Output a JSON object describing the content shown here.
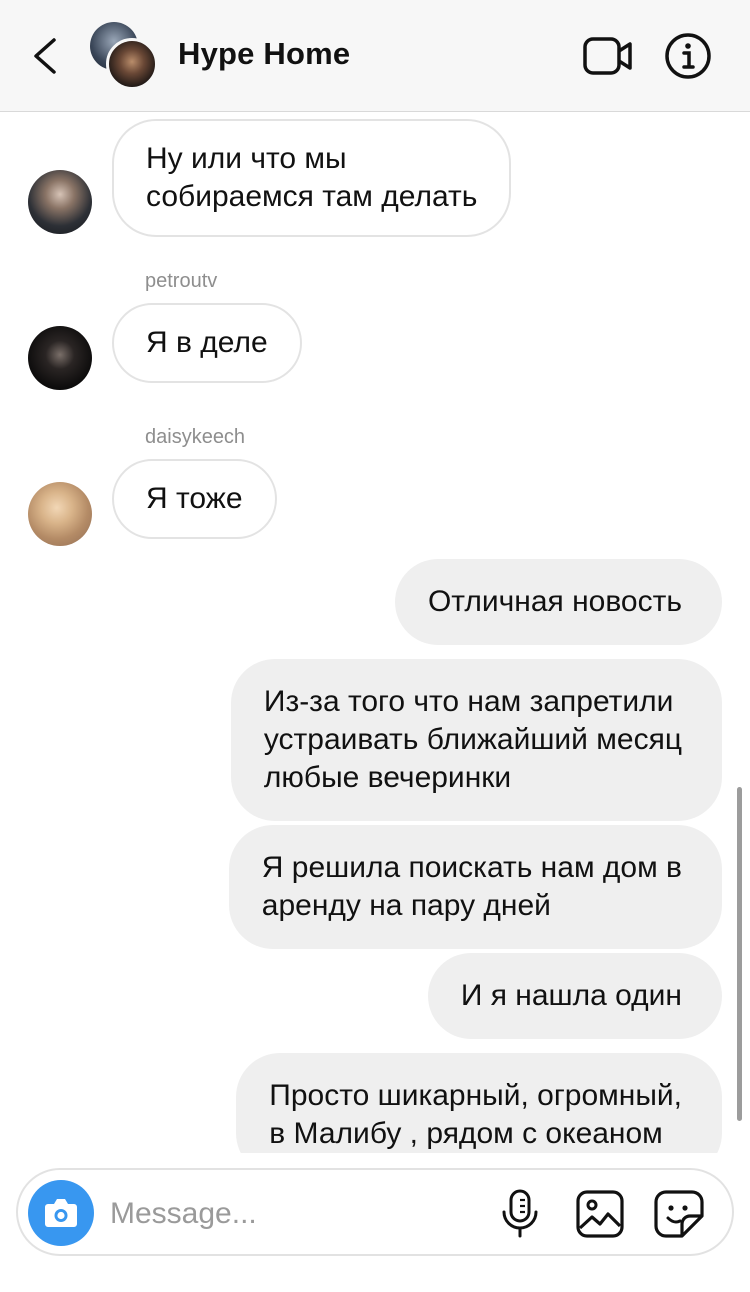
{
  "header": {
    "title": "Hype Home",
    "back_icon": "chevron-left-icon",
    "video_icon": "video-camera-icon",
    "info_icon": "info-icon"
  },
  "messages": [
    {
      "direction": "in",
      "sender": "",
      "text_lines": [
        "Ну или что мы",
        "собираемся там делать"
      ]
    },
    {
      "direction": "in",
      "sender": "petroutv",
      "text_lines": [
        "Я в деле"
      ]
    },
    {
      "direction": "in",
      "sender": "daisykeech",
      "text_lines": [
        "Я тоже"
      ]
    },
    {
      "direction": "out",
      "text_lines": [
        "Отличная новость"
      ]
    },
    {
      "direction": "out",
      "text_lines": [
        "Из-за того что нам запретили",
        "устраивать ближайший месяц",
        "любые вечеринки"
      ]
    },
    {
      "direction": "out",
      "text_lines": [
        "Я решила поискать нам дом в",
        "аренду на пару дней"
      ]
    },
    {
      "direction": "out",
      "text_lines": [
        "И я нашла один"
      ]
    },
    {
      "direction": "out",
      "text_lines": [
        "Просто шикарный, огромный,",
        "в Малибу , рядом с океаном"
      ]
    }
  ],
  "composer": {
    "placeholder": "Message...",
    "camera_icon": "camera-icon",
    "mic_icon": "microphone-icon",
    "gallery_icon": "image-gallery-icon",
    "sticker_icon": "sticker-icon"
  },
  "colors": {
    "accent": "#3897f0",
    "outgoing_bubble": "#efefef",
    "header_bg": "#f7f7f7"
  }
}
